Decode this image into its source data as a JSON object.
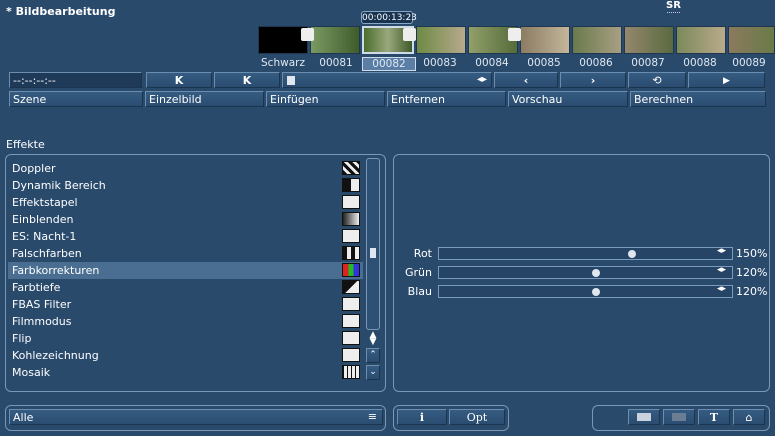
{
  "header": {
    "title": "* Bildbearbeitung",
    "timecode": "00:00:13:23",
    "logo": "SR"
  },
  "timeline": {
    "labels": [
      "Schwarz",
      "00081",
      "00082",
      "00083",
      "00084",
      "00085",
      "00086",
      "00087",
      "00088",
      "00089"
    ],
    "selected": "00082"
  },
  "transport": {
    "timecode_field": "--:--:--:--",
    "btn_start": "K",
    "btn_end": "K",
    "btn_rev": "‹",
    "btn_fwd": "›",
    "btn_loop": "⟲",
    "btn_play": "▶"
  },
  "menu": {
    "szene": "Szene",
    "einzelbild": "Einzelbild",
    "einfuegen": "Einfügen",
    "entfernen": "Entfernen",
    "vorschau": "Vorschau",
    "berechnen": "Berechnen"
  },
  "effects": {
    "heading": "Effekte",
    "items": [
      "Doppler",
      "Dynamik Bereich",
      "Effektstapel",
      "Einblenden",
      "ES: Nacht-1",
      "Falschfarben",
      "Farbkorrekturen",
      "Farbtiefe",
      "FBAS Filter",
      "Filmmodus",
      "Flip",
      "Kohlezeichnung",
      "Mosaik"
    ],
    "selected": "Farbkorrekturen"
  },
  "params": [
    {
      "label": "Rot",
      "value": "150%",
      "fraction": 0.72
    },
    {
      "label": "Grün",
      "value": "120%",
      "fraction": 0.58
    },
    {
      "label": "Blau",
      "value": "120%",
      "fraction": 0.58
    }
  ],
  "filter": {
    "value": "Alle"
  },
  "bottom": {
    "info": "i",
    "opt": "Opt",
    "t_label": "T"
  },
  "colors": {
    "bg": "#2a4a6c",
    "selected": "#4a6e92",
    "frame_selected": "#5a7ea6"
  }
}
